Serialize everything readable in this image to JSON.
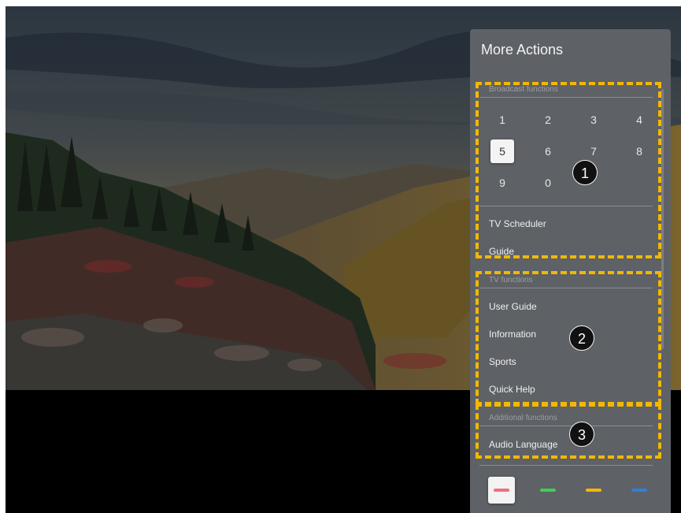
{
  "panel": {
    "title": "More Actions",
    "broadcast": {
      "label": "Broadcast functions",
      "keys": [
        "1",
        "2",
        "3",
        "4",
        "5",
        "6",
        "7",
        "8",
        "9",
        "0"
      ],
      "selected_key": "5",
      "items": [
        "TV Scheduler",
        "Guide"
      ]
    },
    "tv": {
      "label": "TV functions",
      "items": [
        "User Guide",
        "Information",
        "Sports",
        "Quick Help"
      ]
    },
    "additional": {
      "label": "Additional functions",
      "items": [
        "Audio Language"
      ]
    },
    "color_buttons": [
      {
        "name": "red",
        "color": "#f06e7e"
      },
      {
        "name": "green",
        "color": "#3ecf5a"
      },
      {
        "name": "yellow",
        "color": "#f2b800"
      },
      {
        "name": "blue",
        "color": "#2f7de1"
      }
    ]
  },
  "callouts": [
    "1",
    "2",
    "3"
  ],
  "colors": {
    "highlight": "#f2b800",
    "panel": "#5e6166"
  }
}
